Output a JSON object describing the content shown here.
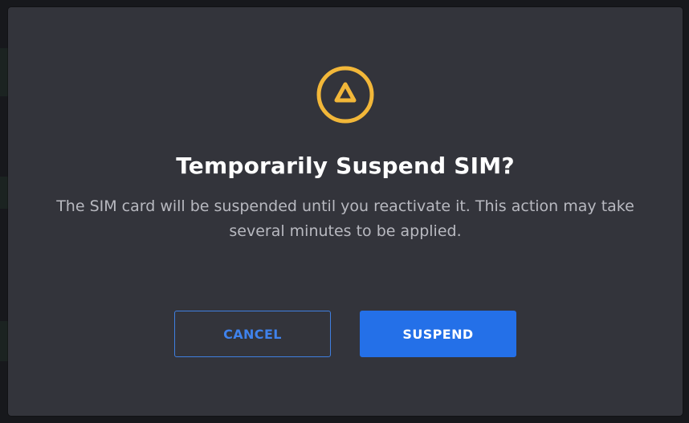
{
  "dialog": {
    "icon": "warning-triangle-icon",
    "icon_color": "#f2b739",
    "title": "Temporarily Suspend SIM?",
    "message": "The SIM card will be suspended until you reactivate it. This action may take several minutes to be applied.",
    "cancel_label": "CANCEL",
    "confirm_label": "SUSPEND"
  },
  "colors": {
    "modal_background": "#33343b",
    "primary": "#2470e8",
    "warning": "#f2b739"
  }
}
